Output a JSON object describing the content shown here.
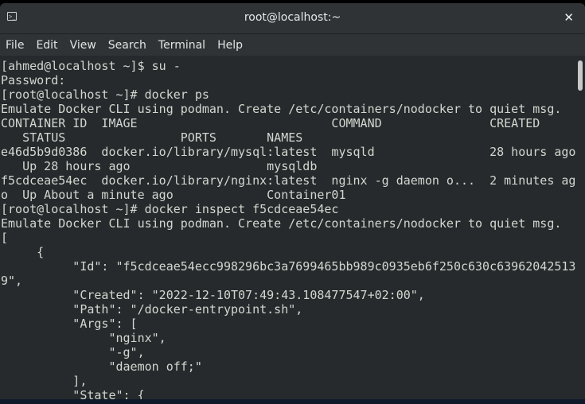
{
  "window": {
    "title": "root@localhost:~",
    "icon": "terminal-icon",
    "close_label": "✕"
  },
  "menu": [
    "File",
    "Edit",
    "View",
    "Search",
    "Terminal",
    "Help"
  ],
  "terminal": {
    "lines": [
      "[ahmed@localhost ~]$ su -",
      "Password:",
      "[root@localhost ~]# docker ps",
      "Emulate Docker CLI using podman. Create /etc/containers/nodocker to quiet msg.",
      "CONTAINER ID  IMAGE                           COMMAND               CREATED",
      "   STATUS                PORTS       NAMES",
      "e46d5b9d0386  docker.io/library/mysql:latest  mysqld                28 hours ago",
      "   Up 28 hours ago                   mysqldb",
      "f5cdceae54ec  docker.io/library/nginx:latest  nginx -g daemon o...  2 minutes ag",
      "o  Up About a minute ago             Container01",
      "[root@localhost ~]# docker inspect f5cdceae54ec",
      "Emulate Docker CLI using podman. Create /etc/containers/nodocker to quiet msg.",
      "[",
      "     {",
      "          \"Id\": \"f5cdceae54ecc998296bc3a7699465bb989c0935eb6f250c630c63962042513",
      "9\",",
      "          \"Created\": \"2022-12-10T07:49:43.108477547+02:00\",",
      "          \"Path\": \"/docker-entrypoint.sh\",",
      "          \"Args\": [",
      "               \"nginx\",",
      "               \"-g\",",
      "               \"daemon off;\"",
      "          ],",
      "          \"State\": {"
    ]
  }
}
